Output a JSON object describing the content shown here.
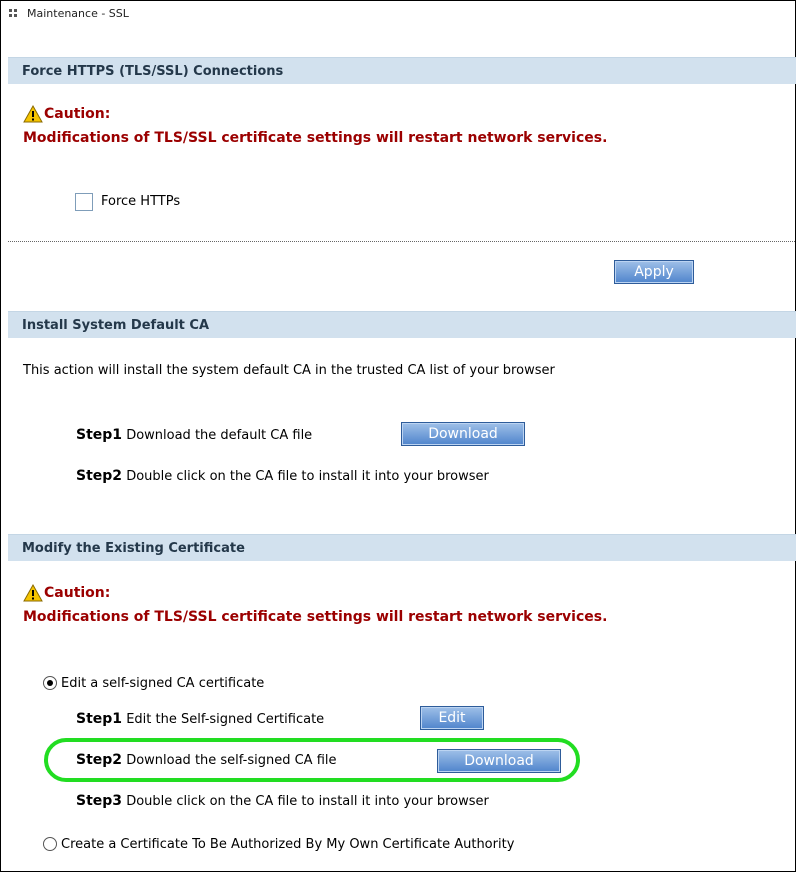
{
  "window": {
    "title": "Maintenance - SSL"
  },
  "sections": {
    "force_https": {
      "header": "Force HTTPS (TLS/SSL) Connections",
      "caution_title": "Caution:",
      "caution_text": "Modifications of TLS/SSL certificate settings will restart network services.",
      "checkbox_label": "Force HTTPs",
      "checkbox_checked": false,
      "apply_label": "Apply"
    },
    "install_ca": {
      "header": "Install System Default CA",
      "description": "This action will install the system default CA in the trusted CA list of your browser",
      "step1_label": "Step1",
      "step1_text": "Download the default CA file",
      "step1_button": "Download",
      "step2_label": "Step2",
      "step2_text": "Double click on the CA file to install it into your browser"
    },
    "modify_cert": {
      "header": "Modify the Existing Certificate",
      "caution_title": "Caution:",
      "caution_text": "Modifications of TLS/SSL certificate settings will restart network services.",
      "option1_label": "Edit a self-signed CA certificate",
      "option1_selected": true,
      "step1_label": "Step1",
      "step1_text": "Edit the Self-signed Certificate",
      "step1_button": "Edit",
      "step2_label": "Step2",
      "step2_text": "Download the self-signed CA file",
      "step2_button": "Download",
      "step3_label": "Step3",
      "step3_text": "Double click on the CA file to install it into your browser",
      "option2_label": "Create a Certificate To Be Authorized By My Own Certificate Authority",
      "option2_selected": false
    }
  },
  "colors": {
    "section_bg": "#d2e1ee",
    "caution": "#9b0000",
    "highlight": "#22dd22",
    "button": "#4f84cc"
  }
}
